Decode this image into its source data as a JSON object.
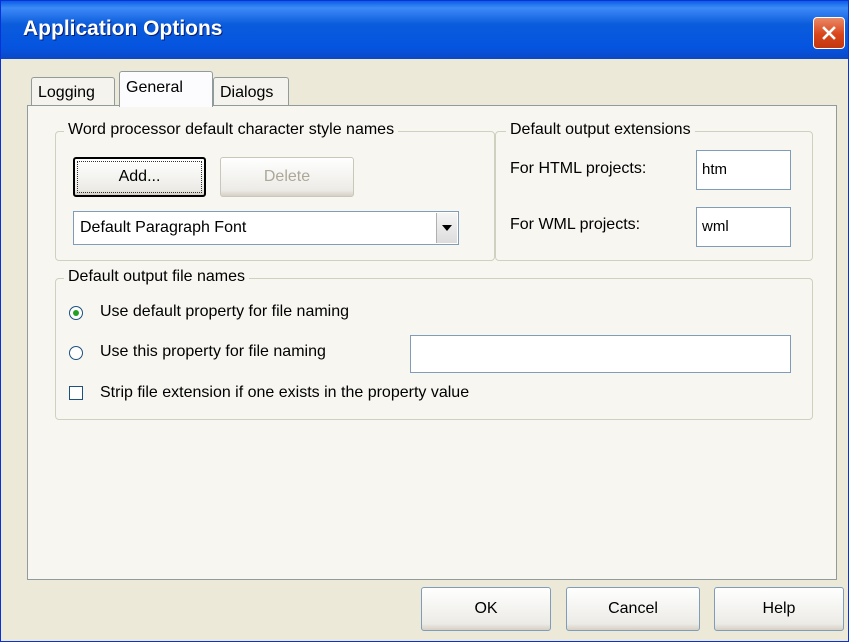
{
  "window": {
    "title": "Application Options"
  },
  "tabs": [
    {
      "label": "Logging",
      "active": false
    },
    {
      "label": "General",
      "active": true
    },
    {
      "label": "Dialogs",
      "active": false
    }
  ],
  "style_group": {
    "legend": "Word processor default character style names",
    "add_label": "Add...",
    "delete_label": "Delete",
    "combo_value": "Default Paragraph Font"
  },
  "ext_group": {
    "legend": "Default output extensions",
    "html_label": "For HTML projects:",
    "html_value": "htm",
    "wml_label": "For WML projects:",
    "wml_value": "wml"
  },
  "filenames_group": {
    "legend": "Default output file names",
    "radio_default": "Use default property for file naming",
    "radio_default_selected": true,
    "radio_custom": "Use this property for file naming",
    "radio_custom_selected": false,
    "property_value": "",
    "strip_ext_label": "Strip file extension if one exists in the property value",
    "strip_ext_checked": false
  },
  "footer": {
    "ok_label": "OK",
    "cancel_label": "Cancel",
    "help_label": "Help"
  }
}
